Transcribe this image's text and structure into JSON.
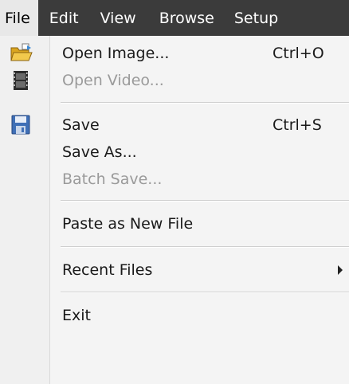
{
  "menubar": {
    "items": [
      {
        "label": "File"
      },
      {
        "label": "Edit"
      },
      {
        "label": "View"
      },
      {
        "label": "Browse"
      },
      {
        "label": "Setup"
      }
    ]
  },
  "file_menu": {
    "open_image": {
      "label": "Open Image...",
      "shortcut": "Ctrl+O",
      "icon": "open-folder-icon"
    },
    "open_video": {
      "label": "Open Video...",
      "icon": "film-icon"
    },
    "save": {
      "label": "Save",
      "shortcut": "Ctrl+S",
      "icon": "floppy-disk-icon"
    },
    "save_as": {
      "label": "Save As..."
    },
    "batch_save": {
      "label": "Batch Save..."
    },
    "paste_new": {
      "label": "Paste as New File"
    },
    "recent_files": {
      "label": "Recent Files"
    },
    "exit": {
      "label": "Exit"
    }
  },
  "colors": {
    "menubar_bg": "#3b3b3b",
    "menu_bg": "#f4f4f4",
    "disabled_text": "#9a9a9a"
  }
}
